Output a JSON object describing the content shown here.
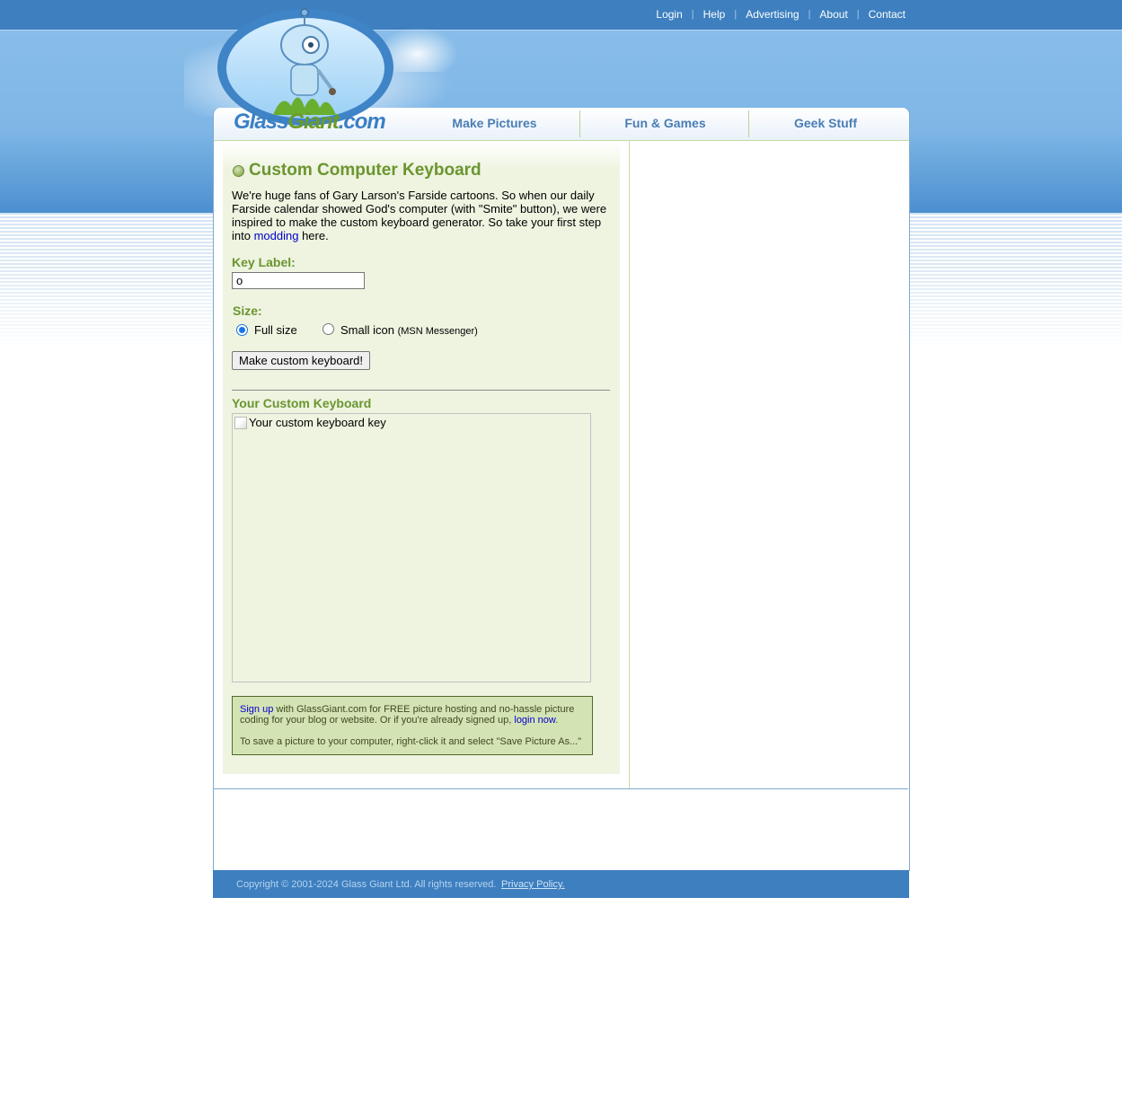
{
  "topnav": {
    "items": [
      "Login",
      "Help",
      "Advertising",
      "About",
      "Contact"
    ],
    "separator": "|"
  },
  "logo": {
    "part1": "Glass",
    "part2": "Giant",
    "part3": ".com"
  },
  "mainnav": {
    "tabs": [
      "Make Pictures",
      "Fun & Games",
      "Geek Stuff"
    ]
  },
  "page": {
    "title": "Custom Computer Keyboard",
    "intro_before_link": "We're huge fans of Gary Larson's Farside cartoons. So when our daily Farside calendar showed God's computer (with \"Smite\" button), we were inspired to make the custom keyboard generator. So take your first step into ",
    "intro_link": "modding",
    "intro_after_link": " here."
  },
  "form": {
    "key_label_heading": "Key Label:",
    "key_label_value": "o",
    "size_heading": "Size:",
    "size_option_full": "Full size",
    "size_option_small": "Small icon",
    "size_option_small_note": "(MSN Messenger)",
    "selected_size": "Full size",
    "submit_label": "Make custom keyboard!"
  },
  "result": {
    "heading": "Your Custom Keyboard",
    "image_alt": "Your custom keyboard key"
  },
  "info": {
    "signup_link": "Sign up",
    "text1": " with GlassGiant.com for FREE picture hosting and no-hassle picture coding for your blog or website. Or if you're already signed up, ",
    "login_link": "login now",
    "text2": ".",
    "save_hint": "To save a picture to your computer, right-click it and select \"Save Picture As...\""
  },
  "footer": {
    "copyright": "Copyright © 2001-2024 Glass Giant Ltd. All rights reserved.",
    "privacy": "Privacy Policy."
  },
  "colors": {
    "topbar": "#3d7fbf",
    "accent_green": "#6b9530",
    "nav_blue": "#4a7db5",
    "panel_green": "#eef4e0",
    "link": "#0000cc"
  }
}
